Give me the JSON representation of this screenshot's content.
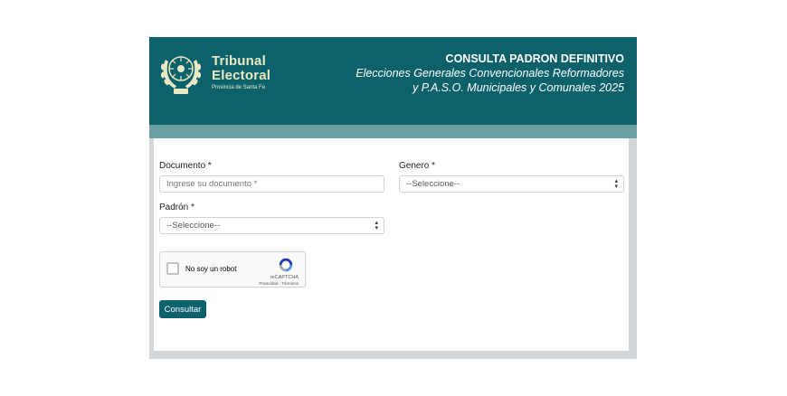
{
  "header": {
    "brand_line1": "Tribunal",
    "brand_line2": "Electoral",
    "brand_line3": "Provincia de Santa Fe",
    "title": "CONSULTA PADRON DEFINITIVO",
    "subtitle_line1": "Elecciones Generales Convencionales Reformadores",
    "subtitle_line2": "y P.A.S.O. Municipales y Comunales 2025"
  },
  "form": {
    "documento_label": "Documento *",
    "documento_placeholder": "Ingrese su documento *",
    "documento_value": "",
    "genero_label": "Genero *",
    "genero_selected": "--Seleccione--",
    "padron_label": "Padrón *",
    "padron_selected": "--Seleccione--",
    "submit_label": "Consultar"
  },
  "recaptcha": {
    "checkbox_label": "No soy un robot",
    "brand": "reCAPTCHA",
    "links": "Privacidad - Términos"
  },
  "colors": {
    "header_bg": "#0d616b",
    "subbar_bg": "#6a9fa3",
    "brand_text": "#eae9c4",
    "button_bg": "#0d616b"
  }
}
